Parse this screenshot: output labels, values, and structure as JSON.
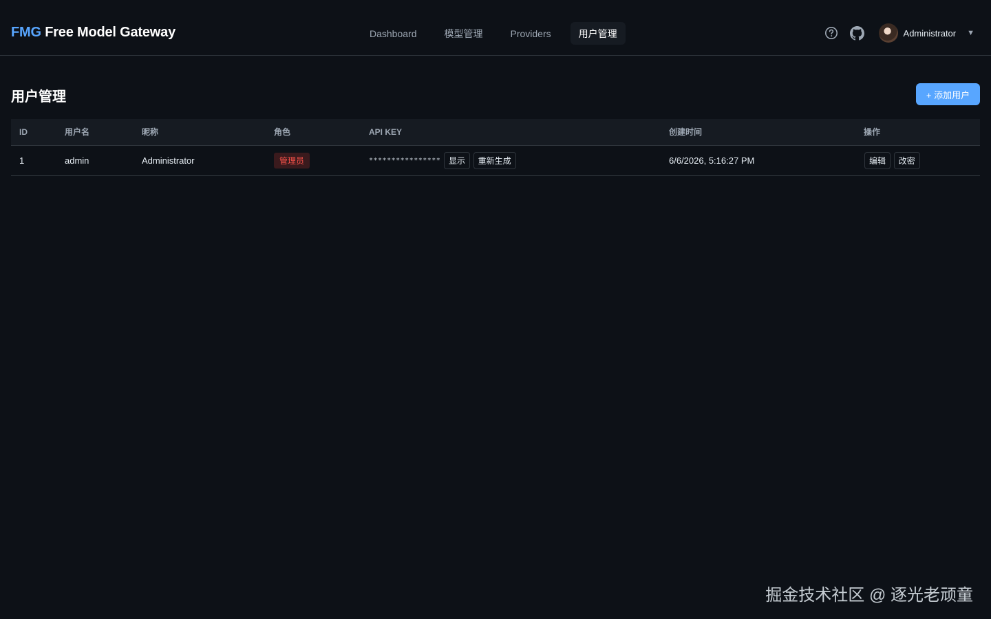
{
  "header": {
    "brand_mark": "FMG",
    "brand_name": " Free Model Gateway",
    "nav": [
      {
        "label": "Dashboard",
        "active": false
      },
      {
        "label": "模型管理",
        "active": false
      },
      {
        "label": "Providers",
        "active": false
      },
      {
        "label": "用户管理",
        "active": true
      }
    ],
    "user_name": "Administrator",
    "caret": "▼",
    "icons": [
      "help-icon",
      "github-icon",
      "avatar",
      "chevron-down-icon"
    ]
  },
  "page": {
    "title": "用户管理",
    "add_button_label": "+ 添加用户"
  },
  "table": {
    "columns": [
      "ID",
      "用户名",
      "昵称",
      "角色",
      "API KEY",
      "创建时间",
      "操作"
    ],
    "rows": [
      {
        "id": "1",
        "username": "admin",
        "nickname": "Administrator",
        "role": "管理员",
        "api_key_masked": "****************",
        "show_label": "显示",
        "regenerate_label": "重新生成",
        "created_at": "6/6/2026, 5:16:27 PM",
        "edit_label": "编辑",
        "change_password_label": "改密"
      }
    ]
  },
  "watermark": "掘金技术社区 @ 逐光老顽童",
  "colors": {
    "background": "#0d1117",
    "accent": "#58a6ff",
    "border": "#30363d",
    "admin_badge": "#f85149"
  }
}
